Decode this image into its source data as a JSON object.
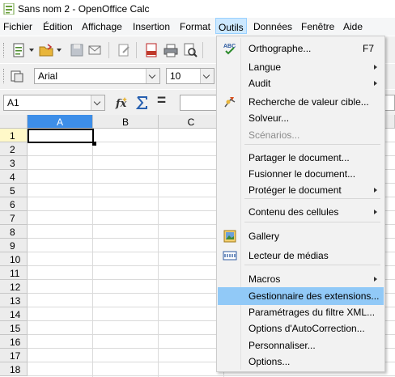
{
  "window": {
    "title": "Sans nom 2 - OpenOffice Calc"
  },
  "menubar": [
    {
      "label": "Fichier",
      "active": false
    },
    {
      "label": "Édition",
      "active": false
    },
    {
      "label": "Affichage",
      "active": false
    },
    {
      "label": "Insertion",
      "active": false
    },
    {
      "label": "Format",
      "active": false
    },
    {
      "label": "Outils",
      "active": true
    },
    {
      "label": "Données",
      "active": false
    },
    {
      "label": "Fenêtre",
      "active": false
    },
    {
      "label": "Aide",
      "active": false
    }
  ],
  "format_bar": {
    "font_name": "Arial",
    "font_size": "10"
  },
  "formula_bar": {
    "cell_ref": "A1",
    "function_wizard_icon": "fx-icon",
    "sum_icon": "sigma-icon",
    "equals_symbol": "=",
    "formula": ""
  },
  "sheet": {
    "columns": [
      "A",
      "B",
      "C"
    ],
    "rows": [
      "1",
      "2",
      "3",
      "4",
      "5",
      "6",
      "7",
      "8",
      "9",
      "10",
      "11",
      "12",
      "13",
      "14",
      "15",
      "16",
      "17",
      "18"
    ],
    "active_cell": "A1"
  },
  "tools_menu": {
    "items": [
      {
        "label": "Orthographe...",
        "shortcut": "F7",
        "icon": "spellcheck-icon",
        "submenu": false,
        "disabled": false,
        "highlighted": false
      },
      {
        "label": "Langue",
        "shortcut": "",
        "icon": "",
        "submenu": true,
        "disabled": false,
        "highlighted": false
      },
      {
        "label": "Audit",
        "shortcut": "",
        "icon": "",
        "submenu": true,
        "disabled": false,
        "highlighted": false
      },
      {
        "label": "Recherche de valeur cible...",
        "shortcut": "",
        "icon": "goal-seek-icon",
        "submenu": false,
        "disabled": false,
        "highlighted": false
      },
      {
        "label": "Solveur...",
        "shortcut": "",
        "icon": "",
        "submenu": false,
        "disabled": false,
        "highlighted": false
      },
      {
        "label": "Scénarios...",
        "shortcut": "",
        "icon": "",
        "submenu": false,
        "disabled": true,
        "highlighted": false
      },
      {
        "label": "Partager le document...",
        "shortcut": "",
        "icon": "",
        "submenu": false,
        "disabled": false,
        "highlighted": false
      },
      {
        "label": "Fusionner le document...",
        "shortcut": "",
        "icon": "",
        "submenu": false,
        "disabled": false,
        "highlighted": false
      },
      {
        "label": "Protéger le document",
        "shortcut": "",
        "icon": "",
        "submenu": true,
        "disabled": false,
        "highlighted": false
      },
      {
        "label": "Contenu des cellules",
        "shortcut": "",
        "icon": "",
        "submenu": true,
        "disabled": false,
        "highlighted": false
      },
      {
        "label": "Gallery",
        "shortcut": "",
        "icon": "gallery-icon",
        "submenu": false,
        "disabled": false,
        "highlighted": false
      },
      {
        "label": "Lecteur de médias",
        "shortcut": "",
        "icon": "media-player-icon",
        "submenu": false,
        "disabled": false,
        "highlighted": false
      },
      {
        "label": "Macros",
        "shortcut": "",
        "icon": "",
        "submenu": true,
        "disabled": false,
        "highlighted": false
      },
      {
        "label": "Gestionnaire des extensions...",
        "shortcut": "",
        "icon": "",
        "submenu": false,
        "disabled": false,
        "highlighted": true
      },
      {
        "label": "Paramétrages du filtre XML...",
        "shortcut": "",
        "icon": "",
        "submenu": false,
        "disabled": false,
        "highlighted": false
      },
      {
        "label": "Options d'AutoCorrection...",
        "shortcut": "",
        "icon": "",
        "submenu": false,
        "disabled": false,
        "highlighted": false
      },
      {
        "label": "Personnaliser...",
        "shortcut": "",
        "icon": "",
        "submenu": false,
        "disabled": false,
        "highlighted": false
      },
      {
        "label": "Options...",
        "shortcut": "",
        "icon": "",
        "submenu": false,
        "disabled": false,
        "highlighted": false
      }
    ]
  },
  "colors": {
    "selection_blue": "#3d8ee8",
    "menu_highlight": "#91c9f7",
    "active_menu_bg": "#cce8ff"
  }
}
